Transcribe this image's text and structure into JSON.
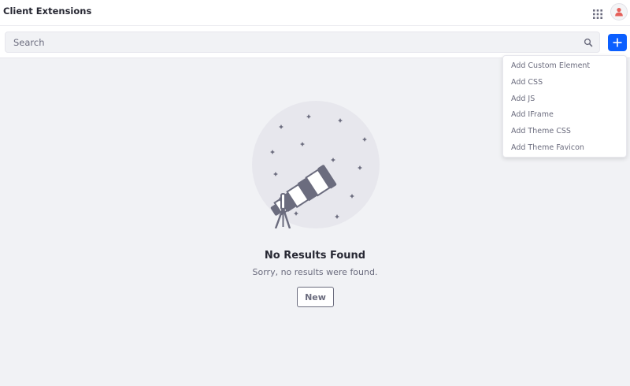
{
  "header": {
    "title": "Client Extensions"
  },
  "search": {
    "placeholder": "Search",
    "value": ""
  },
  "empty_state": {
    "title": "No Results Found",
    "description": "Sorry, no results were found.",
    "button_label": "New"
  },
  "dropdown": {
    "items": [
      {
        "label": "Add Custom Element"
      },
      {
        "label": "Add CSS"
      },
      {
        "label": "Add JS"
      },
      {
        "label": "Add IFrame"
      },
      {
        "label": "Add Theme CSS"
      },
      {
        "label": "Add Theme Favicon"
      }
    ]
  },
  "icons": {
    "apps": "apps-grid-icon",
    "avatar": "user-icon",
    "search": "search-icon",
    "add": "plus-icon"
  },
  "colors": {
    "accent": "#0b5fff",
    "background": "#f1f2f5",
    "avatar_user": "#e5605a"
  }
}
